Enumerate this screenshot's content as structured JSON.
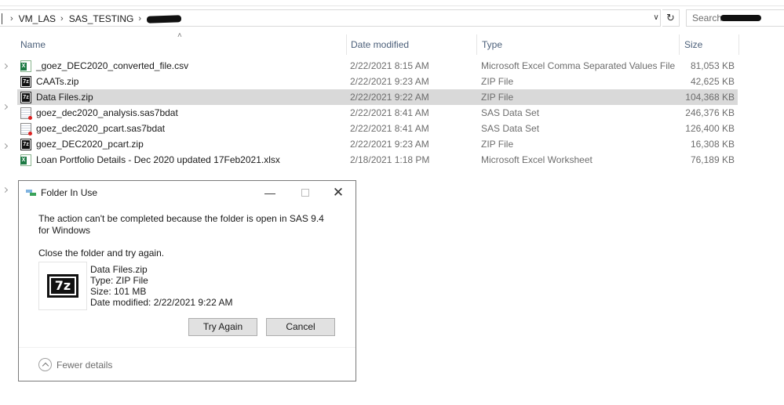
{
  "address": {
    "crumbs": [
      "VM_LAS",
      "SAS_TESTING"
    ],
    "search_placeholder": "Search"
  },
  "columns": {
    "name": "Name",
    "date": "Date modified",
    "type": "Type",
    "size": "Size"
  },
  "files": [
    {
      "name": "_goez_DEC2020_converted_file.csv",
      "date": "2/22/2021 8:15 AM",
      "type": "Microsoft Excel Comma Separated Values File",
      "size": "81,053 KB",
      "icon": "excel-csv-icon",
      "selected": false
    },
    {
      "name": "CAATs.zip",
      "date": "2/22/2021 9:23 AM",
      "type": "ZIP File",
      "size": "42,625 KB",
      "icon": "7zip-icon",
      "selected": false
    },
    {
      "name": "Data Files.zip",
      "date": "2/22/2021 9:22 AM",
      "type": "ZIP File",
      "size": "104,368 KB",
      "icon": "7zip-icon",
      "selected": true
    },
    {
      "name": "goez_dec2020_analysis.sas7bdat",
      "date": "2/22/2021 8:41 AM",
      "type": "SAS Data Set",
      "size": "246,376 KB",
      "icon": "sas-dataset-icon",
      "selected": false
    },
    {
      "name": "goez_dec2020_pcart.sas7bdat",
      "date": "2/22/2021 8:41 AM",
      "type": "SAS Data Set",
      "size": "126,400 KB",
      "icon": "sas-dataset-icon",
      "selected": false
    },
    {
      "name": "goez_DEC2020_pcart.zip",
      "date": "2/22/2021 9:23 AM",
      "type": "ZIP File",
      "size": "16,308 KB",
      "icon": "7zip-icon",
      "selected": false
    },
    {
      "name": "Loan Portfolio Details - Dec 2020 updated 17Feb2021.xlsx",
      "date": "2/18/2021 1:18 PM",
      "type": "Microsoft Excel Worksheet",
      "size": "76,189 KB",
      "icon": "excel-icon",
      "selected": false
    }
  ],
  "dialog": {
    "title": "Folder In Use",
    "message": "The action can't be completed because the folder is open in SAS 9.4 for Windows",
    "instruction": "Close the folder and try again.",
    "file_name": "Data Files.zip",
    "file_type": "Type: ZIP File",
    "file_size": "Size: 101 MB",
    "file_date": "Date modified: 2/22/2021 9:22 AM",
    "try_again": "Try Again",
    "cancel": "Cancel",
    "fewer_details": "Fewer details"
  },
  "colors": {
    "selected_row": "#d9d9d9",
    "header_text": "#4c607a",
    "button_bg": "#e1e1e1"
  }
}
